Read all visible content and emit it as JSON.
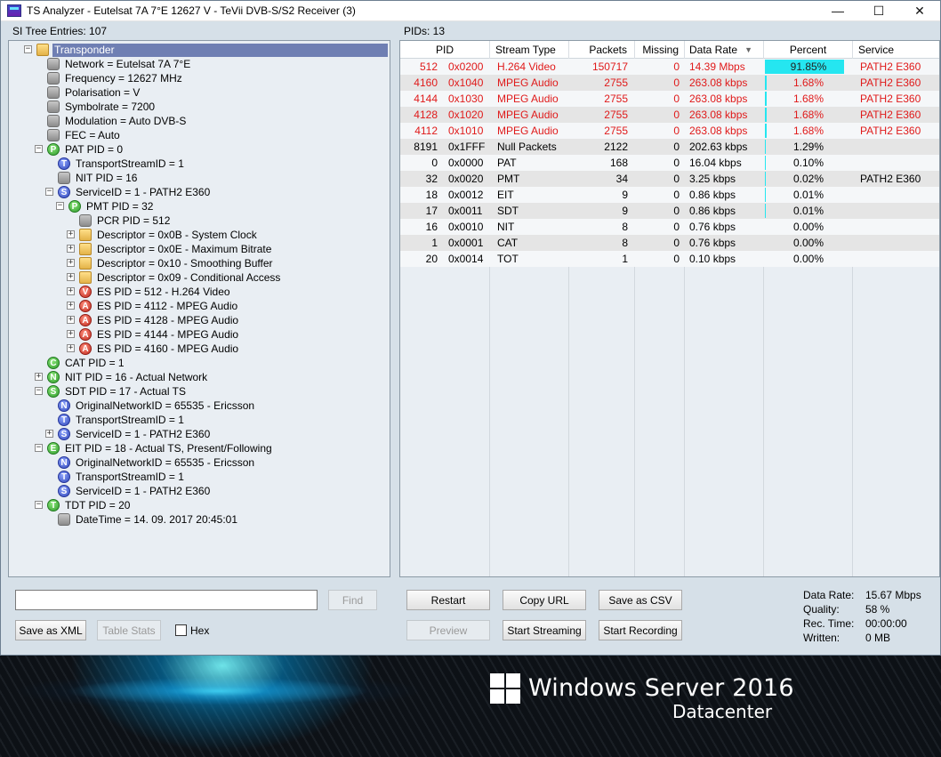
{
  "window": {
    "title": "TS Analyzer - Eutelsat 7A 7°E 12627 V - TeVii DVB-S/S2 Receiver (3)",
    "controls": {
      "minimize": "—",
      "maximize": "☐",
      "close": "✕"
    }
  },
  "tree_panel": {
    "header": "SI Tree Entries: 107",
    "nodes": [
      {
        "label": "Transponder",
        "icon": "folder-icon",
        "depth": 0,
        "exp": "−",
        "selected": true
      },
      {
        "label": "Network = Eutelsat 7A 7°E",
        "icon": "gray",
        "depth": 1
      },
      {
        "label": "Frequency = 12627 MHz",
        "icon": "gray",
        "depth": 1
      },
      {
        "label": "Polarisation = V",
        "icon": "gray",
        "depth": 1
      },
      {
        "label": "Symbolrate = 7200",
        "icon": "gray",
        "depth": 1
      },
      {
        "label": "Modulation = Auto DVB-S",
        "icon": "gray",
        "depth": 1
      },
      {
        "label": "FEC = Auto",
        "icon": "gray",
        "depth": 1
      },
      {
        "label": "PAT PID = 0",
        "icon": "green",
        "letter": "P",
        "depth": 1,
        "exp": "−"
      },
      {
        "label": "TransportStreamID = 1",
        "icon": "blue",
        "letter": "T",
        "depth": 2
      },
      {
        "label": "NIT PID = 16",
        "icon": "gray",
        "depth": 2
      },
      {
        "label": "ServiceID = 1 - PATH2 E360",
        "icon": "blue",
        "letter": "S",
        "depth": 2,
        "exp": "−"
      },
      {
        "label": "PMT PID = 32",
        "icon": "green",
        "letter": "P",
        "depth": 3,
        "exp": "−"
      },
      {
        "label": "PCR PID = 512",
        "icon": "gray",
        "depth": 4
      },
      {
        "label": "Descriptor = 0x0B - System Clock",
        "icon": "folder",
        "depth": 4,
        "exp": "+"
      },
      {
        "label": "Descriptor = 0x0E - Maximum Bitrate",
        "icon": "folder",
        "depth": 4,
        "exp": "+"
      },
      {
        "label": "Descriptor = 0x10 - Smoothing Buffer",
        "icon": "folder",
        "depth": 4,
        "exp": "+"
      },
      {
        "label": "Descriptor = 0x09 - Conditional Access",
        "icon": "folder",
        "depth": 4,
        "exp": "+"
      },
      {
        "label": "ES PID = 512 - H.264 Video",
        "icon": "red",
        "letter": "V",
        "depth": 4,
        "exp": "+"
      },
      {
        "label": "ES PID = 4112 - MPEG Audio",
        "icon": "red",
        "letter": "A",
        "depth": 4,
        "exp": "+"
      },
      {
        "label": "ES PID = 4128 - MPEG Audio",
        "icon": "red",
        "letter": "A",
        "depth": 4,
        "exp": "+"
      },
      {
        "label": "ES PID = 4144 - MPEG Audio",
        "icon": "red",
        "letter": "A",
        "depth": 4,
        "exp": "+"
      },
      {
        "label": "ES PID = 4160 - MPEG Audio",
        "icon": "red",
        "letter": "A",
        "depth": 4,
        "exp": "+"
      },
      {
        "label": "CAT PID = 1",
        "icon": "green",
        "letter": "C",
        "depth": 1
      },
      {
        "label": "NIT PID = 16 - Actual Network",
        "icon": "green",
        "letter": "N",
        "depth": 1,
        "exp": "+"
      },
      {
        "label": "SDT PID = 17 - Actual TS",
        "icon": "green",
        "letter": "S",
        "depth": 1,
        "exp": "−"
      },
      {
        "label": "OriginalNetworkID = 65535 - Ericsson",
        "icon": "blue",
        "letter": "N",
        "depth": 2
      },
      {
        "label": "TransportStreamID = 1",
        "icon": "blue",
        "letter": "T",
        "depth": 2
      },
      {
        "label": "ServiceID = 1 - PATH2 E360",
        "icon": "blue",
        "letter": "S",
        "depth": 2,
        "exp": "+"
      },
      {
        "label": "EIT PID = 18 - Actual TS, Present/Following",
        "icon": "green",
        "letter": "E",
        "depth": 1,
        "exp": "−"
      },
      {
        "label": "OriginalNetworkID = 65535 - Ericsson",
        "icon": "blue",
        "letter": "N",
        "depth": 2
      },
      {
        "label": "TransportStreamID = 1",
        "icon": "blue",
        "letter": "T",
        "depth": 2
      },
      {
        "label": "ServiceID = 1 - PATH2 E360",
        "icon": "blue",
        "letter": "S",
        "depth": 2
      },
      {
        "label": "TDT PID = 20",
        "icon": "green",
        "letter": "T",
        "depth": 1,
        "exp": "−"
      },
      {
        "label": "DateTime = 14. 09. 2017 20:45:01",
        "icon": "gray",
        "depth": 2
      }
    ]
  },
  "pid_panel": {
    "header": "PIDs: 13",
    "columns": [
      "PID",
      "Stream Type",
      "Packets",
      "Missing",
      "Data Rate",
      "Percent",
      "Service"
    ],
    "sort_indicator": "▼",
    "rows": [
      {
        "pid": "512",
        "hex": "0x0200",
        "type": "H.264 Video",
        "packets": "150717",
        "missing": "0",
        "rate": "14.39 Mbps",
        "percent": "91.85%",
        "pct": 91.85,
        "service": "PATH2 E360",
        "red": true
      },
      {
        "pid": "4160",
        "hex": "0x1040",
        "type": "MPEG Audio",
        "packets": "2755",
        "missing": "0",
        "rate": "263.08 kbps",
        "percent": "1.68%",
        "pct": 1.68,
        "service": "PATH2 E360",
        "red": true
      },
      {
        "pid": "4144",
        "hex": "0x1030",
        "type": "MPEG Audio",
        "packets": "2755",
        "missing": "0",
        "rate": "263.08 kbps",
        "percent": "1.68%",
        "pct": 1.68,
        "service": "PATH2 E360",
        "red": true
      },
      {
        "pid": "4128",
        "hex": "0x1020",
        "type": "MPEG Audio",
        "packets": "2755",
        "missing": "0",
        "rate": "263.08 kbps",
        "percent": "1.68%",
        "pct": 1.68,
        "service": "PATH2 E360",
        "red": true
      },
      {
        "pid": "4112",
        "hex": "0x1010",
        "type": "MPEG Audio",
        "packets": "2755",
        "missing": "0",
        "rate": "263.08 kbps",
        "percent": "1.68%",
        "pct": 1.68,
        "service": "PATH2 E360",
        "red": true
      },
      {
        "pid": "8191",
        "hex": "0x1FFF",
        "type": "Null Packets",
        "packets": "2122",
        "missing": "0",
        "rate": "202.63 kbps",
        "percent": "1.29%",
        "pct": 1.29,
        "service": "",
        "red": false
      },
      {
        "pid": "0",
        "hex": "0x0000",
        "type": "PAT",
        "packets": "168",
        "missing": "0",
        "rate": "16.04 kbps",
        "percent": "0.10%",
        "pct": 0.1,
        "service": "",
        "red": false
      },
      {
        "pid": "32",
        "hex": "0x0020",
        "type": "PMT",
        "packets": "34",
        "missing": "0",
        "rate": "3.25 kbps",
        "percent": "0.02%",
        "pct": 0.02,
        "service": "PATH2 E360",
        "red": false
      },
      {
        "pid": "18",
        "hex": "0x0012",
        "type": "EIT",
        "packets": "9",
        "missing": "0",
        "rate": "0.86 kbps",
        "percent": "0.01%",
        "pct": 0.01,
        "service": "",
        "red": false
      },
      {
        "pid": "17",
        "hex": "0x0011",
        "type": "SDT",
        "packets": "9",
        "missing": "0",
        "rate": "0.86 kbps",
        "percent": "0.01%",
        "pct": 0.01,
        "service": "",
        "red": false
      },
      {
        "pid": "16",
        "hex": "0x0010",
        "type": "NIT",
        "packets": "8",
        "missing": "0",
        "rate": "0.76 kbps",
        "percent": "0.00%",
        "pct": 0.0,
        "service": "",
        "red": false
      },
      {
        "pid": "1",
        "hex": "0x0001",
        "type": "CAT",
        "packets": "8",
        "missing": "0",
        "rate": "0.76 kbps",
        "percent": "0.00%",
        "pct": 0.0,
        "service": "",
        "red": false
      },
      {
        "pid": "20",
        "hex": "0x0014",
        "type": "TOT",
        "packets": "1",
        "missing": "0",
        "rate": "0.10 kbps",
        "percent": "0.00%",
        "pct": 0.0,
        "service": "",
        "red": false
      }
    ]
  },
  "search": {
    "value": "",
    "find_label": "Find"
  },
  "buttons": {
    "save_xml": "Save as XML",
    "table_stats": "Table Stats",
    "hex": "Hex",
    "restart": "Restart",
    "copy_url": "Copy URL",
    "save_csv": "Save as CSV",
    "preview": "Preview",
    "start_streaming": "Start Streaming",
    "start_recording": "Start Recording"
  },
  "stats": {
    "data_rate_label": "Data Rate:",
    "data_rate": "15.67 Mbps",
    "quality_label": "Quality:",
    "quality": "58 %",
    "rec_time_label": "Rec. Time:",
    "rec_time": "00:00:00",
    "written_label": "Written:",
    "written": "0 MB"
  },
  "desktop": {
    "os_title": "Windows Server 2016",
    "os_edition": "Datacenter"
  },
  "colors": {
    "accent_red": "#e01a1a",
    "percent_bar": "#25e6f0",
    "selection": "#6f7fb3"
  }
}
